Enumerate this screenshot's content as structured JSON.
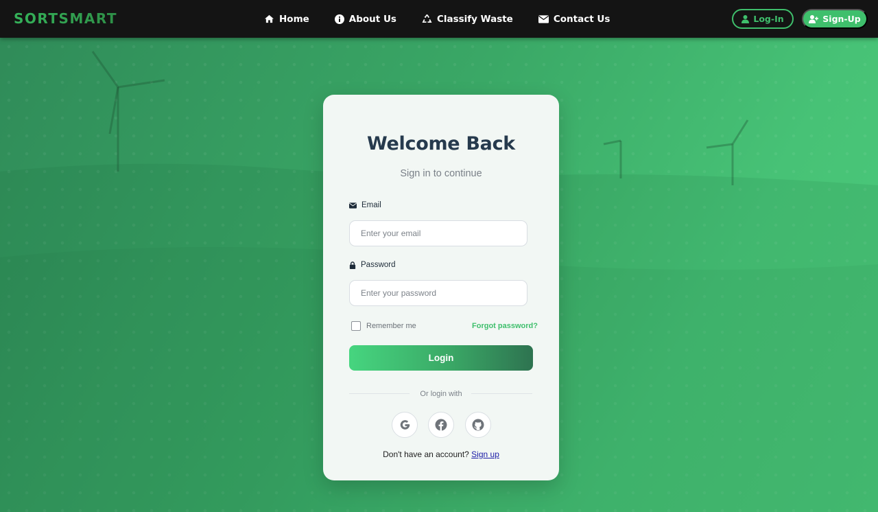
{
  "brand": {
    "name": "SORTSMART"
  },
  "nav": {
    "links": [
      {
        "label": "Home",
        "icon": "home-icon"
      },
      {
        "label": "About Us",
        "icon": "info-icon"
      },
      {
        "label": "Classify Waste",
        "icon": "recycle-icon"
      },
      {
        "label": "Contact Us",
        "icon": "envelope-icon"
      }
    ],
    "login_label": "Log-In",
    "signup_label": "Sign-Up"
  },
  "card": {
    "title": "Welcome Back",
    "subtitle": "Sign in to continue",
    "email": {
      "label": "Email",
      "placeholder": "Enter your email",
      "value": ""
    },
    "password": {
      "label": "Password",
      "placeholder": "Enter your password",
      "value": ""
    },
    "remember_label": "Remember me",
    "remember_checked": false,
    "forgot_label": "Forgot password?",
    "login_button": "Login",
    "divider_text": "Or login with",
    "social": [
      {
        "name": "google",
        "icon": "google-icon"
      },
      {
        "name": "facebook",
        "icon": "facebook-icon"
      },
      {
        "name": "github",
        "icon": "github-icon"
      }
    ],
    "signup_prompt": "Don't have an account?",
    "signup_link": "Sign up"
  },
  "colors": {
    "accent": "#3fbf6c",
    "navbar_bg": "#141414",
    "title": "#263a4d",
    "background_start": "#2f8a58",
    "background_end": "#4ccb7b"
  }
}
